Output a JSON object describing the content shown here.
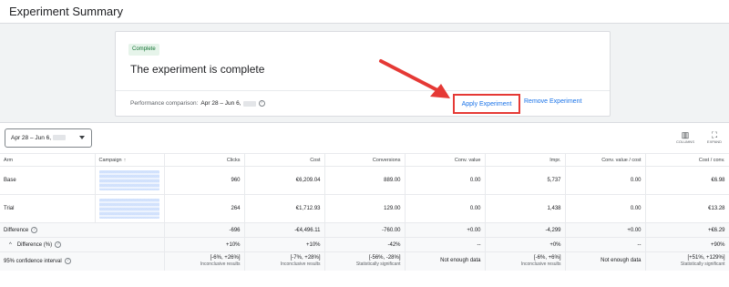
{
  "header": {
    "title": "Experiment Summary"
  },
  "status_card": {
    "chip": "Complete",
    "headline": "The experiment is complete",
    "performance_label": "Performance comparison:",
    "date_range": "Apr 28 – Jun 6,",
    "apply_label": "Apply Experiment",
    "remove_label": "Remove Experiment"
  },
  "toolbar": {
    "date_range": "Apr 28 – Jun 6,",
    "columns_label": "COLUMNS",
    "expand_label": "EXPAND"
  },
  "table": {
    "columns": [
      "Arm",
      "Campaign",
      "Clicks",
      "Cost",
      "Conversions",
      "Conv. value",
      "Impr.",
      "Conv. value / cost",
      "Cost / conv."
    ],
    "rows": [
      {
        "arm": "Base",
        "clicks": "960",
        "cost": "€6,209.04",
        "conversions": "889.00",
        "conv_value": "0.00",
        "impr": "5,737",
        "value_cost": "0.00",
        "cost_conv": "€6.98"
      },
      {
        "arm": "Trial",
        "clicks": "264",
        "cost": "€1,712.93",
        "conversions": "129.00",
        "conv_value": "0.00",
        "impr": "1,438",
        "value_cost": "0.00",
        "cost_conv": "€13.28"
      }
    ],
    "difference": {
      "label": "Difference",
      "clicks": "-696",
      "cost": "-€4,496.11",
      "conversions": "-760.00",
      "conv_value": "+0.00",
      "impr": "-4,299",
      "value_cost": "+0.00",
      "cost_conv": "+€6.29"
    },
    "difference_pct": {
      "label": "Difference (%)",
      "clicks": "+10%",
      "cost": "+10%",
      "conversions": "-42%",
      "conv_value": "--",
      "impr": "+0%",
      "value_cost": "--",
      "cost_conv": "+90%"
    },
    "confidence": {
      "label": "95% confidence interval",
      "clicks": "[-6%, +26%]",
      "clicks_note": "Inconclusive results",
      "cost": "[-7%, +28%]",
      "cost_note": "Inconclusive results",
      "conversions": "[-56%, -28%]",
      "conversions_note": "Statistically significant",
      "conv_value": "Not enough data",
      "impr": "[-6%, +6%]",
      "impr_note": "Inconclusive results",
      "value_cost": "Not enough data",
      "cost_conv": "[+51%, +129%]",
      "cost_conv_note": "Statistically significant"
    }
  },
  "icons": {
    "sort": "arrow-up-icon",
    "help": "question-circle-icon",
    "collapse": "chevron-up-icon",
    "columns": "columns-icon",
    "expand": "fullscreen-icon"
  },
  "colors": {
    "accent": "#1a73e8",
    "highlight": "#e53935",
    "chip_bg": "#e6f4ea",
    "chip_text": "#137333"
  }
}
